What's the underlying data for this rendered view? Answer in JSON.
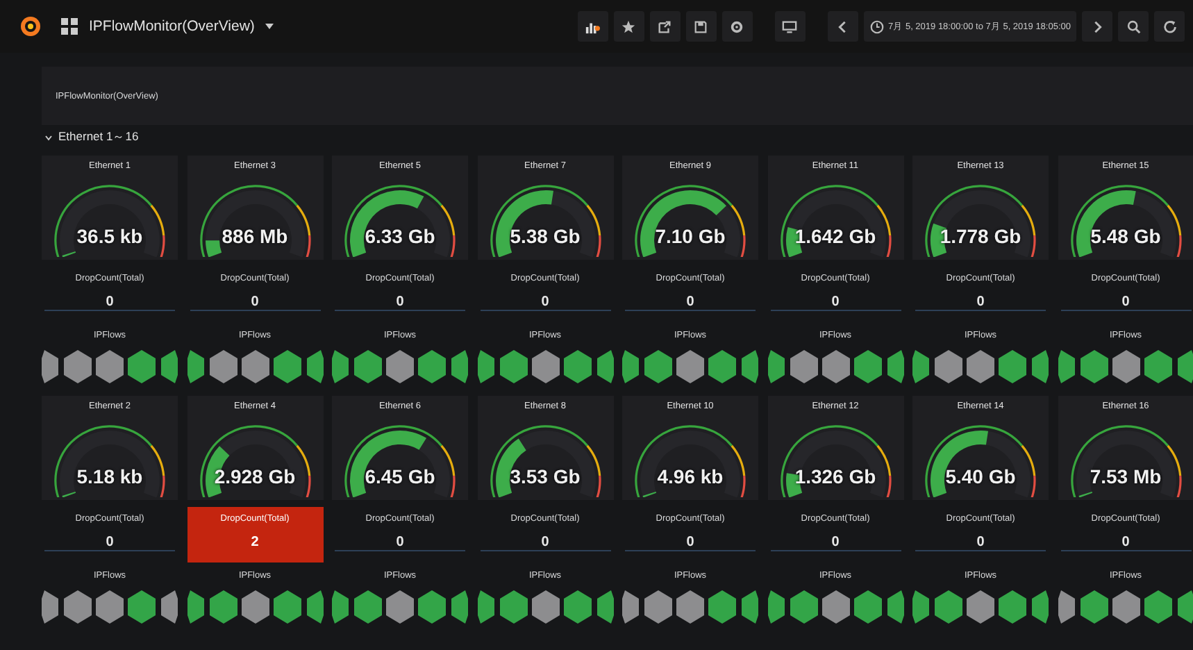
{
  "header": {
    "title": "IPFlowMonitor(OverView)",
    "time_range": "7月 5, 2019 18:00:00 to 7月 5, 2019 18:05:00"
  },
  "text_panel": {
    "content": "IPFlowMonitor(OverView)"
  },
  "row": {
    "title": "Ethernet 1～16",
    "expanded": true
  },
  "ports": [
    {
      "name": "Ethernet 1",
      "traffic": "36.5 kb",
      "drop_label": "DropCount(Total)",
      "drop_count": "0",
      "alert": false,
      "flows_label": "IPFlows",
      "flows": [
        {
          "active": false
        },
        {
          "active": false
        },
        {
          "active": false
        },
        {
          "active": true
        },
        {
          "active": true
        }
      ]
    },
    {
      "name": "Ethernet 3",
      "traffic": "886 Mb",
      "drop_label": "DropCount(Total)",
      "drop_count": "0",
      "alert": false,
      "flows_label": "IPFlows",
      "flows": [
        {
          "active": true
        },
        {
          "active": false
        },
        {
          "active": false
        },
        {
          "active": true
        },
        {
          "active": true
        }
      ]
    },
    {
      "name": "Ethernet 5",
      "traffic": "6.33 Gb",
      "drop_label": "DropCount(Total)",
      "drop_count": "0",
      "alert": false,
      "flows_label": "IPFlows",
      "flows": [
        {
          "active": true
        },
        {
          "active": true
        },
        {
          "active": false
        },
        {
          "active": true
        },
        {
          "active": true
        }
      ]
    },
    {
      "name": "Ethernet 7",
      "traffic": "5.38 Gb",
      "drop_label": "DropCount(Total)",
      "drop_count": "0",
      "alert": false,
      "flows_label": "IPFlows",
      "flows": [
        {
          "active": true
        },
        {
          "active": true
        },
        {
          "active": false
        },
        {
          "active": true
        },
        {
          "active": true
        }
      ]
    },
    {
      "name": "Ethernet 9",
      "traffic": "7.10 Gb",
      "drop_label": "DropCount(Total)",
      "drop_count": "0",
      "alert": false,
      "flows_label": "IPFlows",
      "flows": [
        {
          "active": true
        },
        {
          "active": true
        },
        {
          "active": false
        },
        {
          "active": true
        },
        {
          "active": true
        }
      ]
    },
    {
      "name": "Ethernet 11",
      "traffic": "1.642 Gb",
      "drop_label": "DropCount(Total)",
      "drop_count": "0",
      "alert": false,
      "flows_label": "IPFlows",
      "flows": [
        {
          "active": true
        },
        {
          "active": false
        },
        {
          "active": false
        },
        {
          "active": true
        },
        {
          "active": true
        }
      ]
    },
    {
      "name": "Ethernet 13",
      "traffic": "1.778 Gb",
      "drop_label": "DropCount(Total)",
      "drop_count": "0",
      "alert": false,
      "flows_label": "IPFlows",
      "flows": [
        {
          "active": true
        },
        {
          "active": false
        },
        {
          "active": false
        },
        {
          "active": true
        },
        {
          "active": true
        }
      ]
    },
    {
      "name": "Ethernet 15",
      "traffic": "5.48 Gb",
      "drop_label": "DropCount(Total)",
      "drop_count": "0",
      "alert": false,
      "flows_label": "IPFlows",
      "flows": [
        {
          "active": true
        },
        {
          "active": true
        },
        {
          "active": false
        },
        {
          "active": true
        },
        {
          "active": true
        }
      ]
    },
    {
      "name": "Ethernet 2",
      "traffic": "5.18 kb",
      "drop_label": "DropCount(Total)",
      "drop_count": "0",
      "alert": false,
      "flows_label": "IPFlows",
      "flows": [
        {
          "active": false
        },
        {
          "active": false
        },
        {
          "active": false
        },
        {
          "active": true
        },
        {
          "active": false
        }
      ]
    },
    {
      "name": "Ethernet 4",
      "traffic": "2.928 Gb",
      "drop_label": "DropCount(Total)",
      "drop_count": "2",
      "alert": true,
      "flows_label": "IPFlows",
      "flows": [
        {
          "active": true
        },
        {
          "active": true
        },
        {
          "active": false
        },
        {
          "active": true
        },
        {
          "active": true
        }
      ]
    },
    {
      "name": "Ethernet 6",
      "traffic": "6.45 Gb",
      "drop_label": "DropCount(Total)",
      "drop_count": "0",
      "alert": false,
      "flows_label": "IPFlows",
      "flows": [
        {
          "active": true
        },
        {
          "active": true
        },
        {
          "active": false
        },
        {
          "active": true
        },
        {
          "active": true
        }
      ]
    },
    {
      "name": "Ethernet 8",
      "traffic": "3.53 Gb",
      "drop_label": "DropCount(Total)",
      "drop_count": "0",
      "alert": false,
      "flows_label": "IPFlows",
      "flows": [
        {
          "active": true
        },
        {
          "active": true
        },
        {
          "active": false
        },
        {
          "active": true
        },
        {
          "active": true
        }
      ]
    },
    {
      "name": "Ethernet 10",
      "traffic": "4.96 kb",
      "drop_label": "DropCount(Total)",
      "drop_count": "0",
      "alert": false,
      "flows_label": "IPFlows",
      "flows": [
        {
          "active": false
        },
        {
          "active": false
        },
        {
          "active": false
        },
        {
          "active": true
        },
        {
          "active": true
        }
      ]
    },
    {
      "name": "Ethernet 12",
      "traffic": "1.326 Gb",
      "drop_label": "DropCount(Total)",
      "drop_count": "0",
      "alert": false,
      "flows_label": "IPFlows",
      "flows": [
        {
          "active": true
        },
        {
          "active": true
        },
        {
          "active": false
        },
        {
          "active": true
        },
        {
          "active": true
        }
      ]
    },
    {
      "name": "Ethernet 14",
      "traffic": "5.40 Gb",
      "drop_label": "DropCount(Total)",
      "drop_count": "0",
      "alert": false,
      "flows_label": "IPFlows",
      "flows": [
        {
          "active": true
        },
        {
          "active": true
        },
        {
          "active": false
        },
        {
          "active": true
        },
        {
          "active": true
        }
      ]
    },
    {
      "name": "Ethernet 16",
      "traffic": "7.53 Mb",
      "drop_label": "DropCount(Total)",
      "drop_count": "0",
      "alert": false,
      "flows_label": "IPFlows",
      "flows": [
        {
          "active": false
        },
        {
          "active": true
        },
        {
          "active": false
        },
        {
          "active": true
        },
        {
          "active": true
        }
      ]
    }
  ]
}
